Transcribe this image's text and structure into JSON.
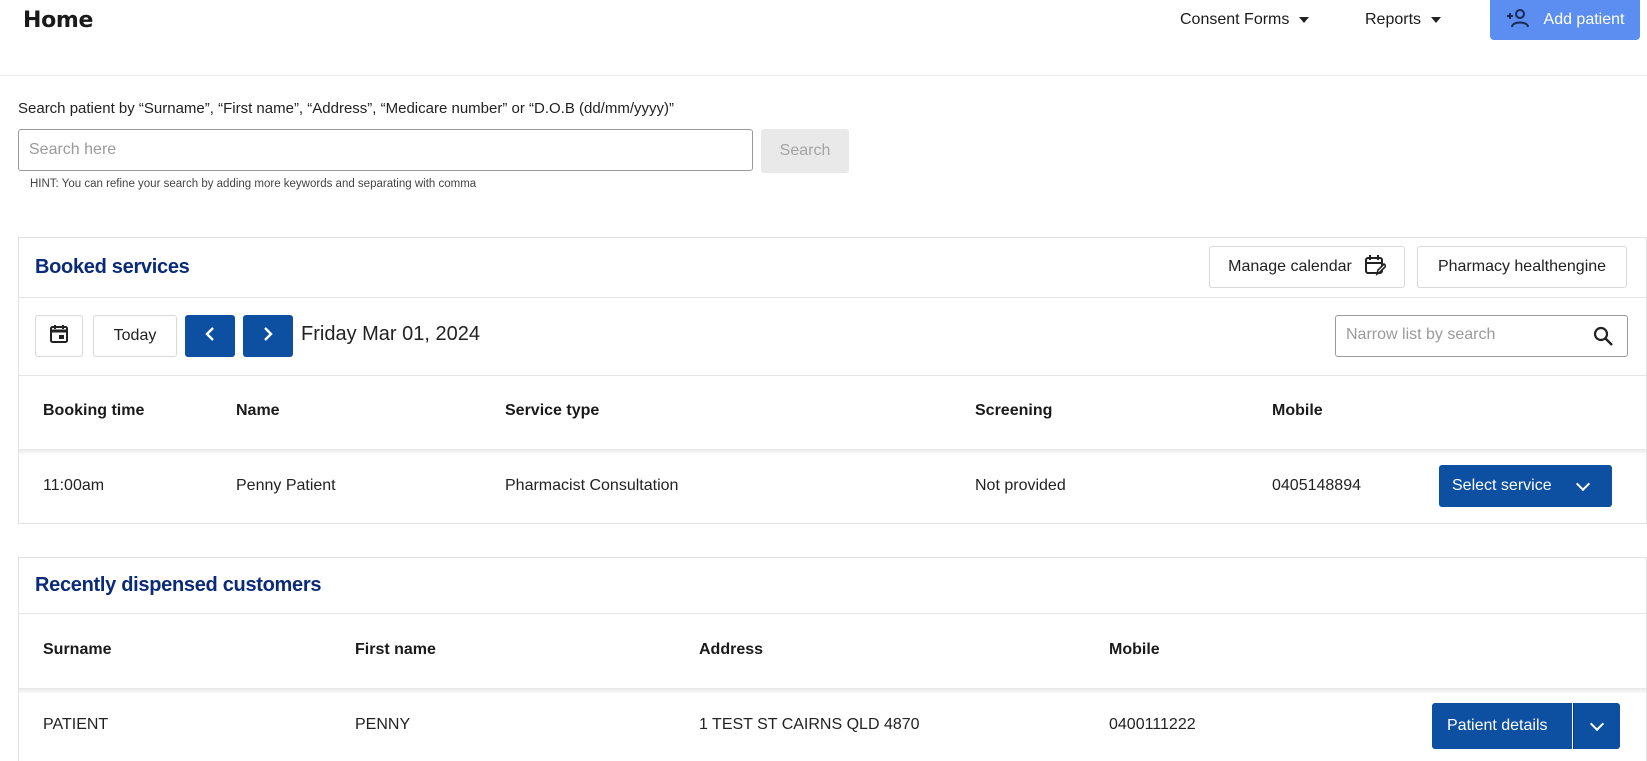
{
  "header": {
    "title": "Home",
    "consent_forms_label": "Consent Forms",
    "reports_label": "Reports",
    "add_patient_label": "Add patient"
  },
  "search": {
    "label": "Search patient by “Surname”, “First name”, “Address”, “Medicare number” or “D.O.B (dd/mm/yyyy)”",
    "placeholder": "Search here",
    "value": "",
    "button_label": "Search",
    "hint": "HINT: You can refine your search by adding more keywords and separating with comma"
  },
  "booked_services": {
    "title": "Booked services",
    "manage_calendar_label": "Manage calendar",
    "healthengine_label": "Pharmacy healthengine",
    "today_label": "Today",
    "date": "Friday Mar 01, 2024",
    "narrow_placeholder": "Narrow list by search",
    "columns": [
      "Booking time",
      "Name",
      "Service type",
      "Screening",
      "Mobile"
    ],
    "rows": [
      {
        "booking_time": "11:00am",
        "name": "Penny Patient",
        "service_type": "Pharmacist Consultation",
        "screening": "Not provided",
        "mobile": "0405148894",
        "action_label": "Select service"
      }
    ]
  },
  "recent_customers": {
    "title": "Recently dispensed customers",
    "columns": [
      "Surname",
      "First name",
      "Address",
      "Mobile"
    ],
    "rows": [
      {
        "surname": "PATIENT",
        "first_name": "PENNY",
        "address": "1 TEST ST CAIRNS QLD 4870",
        "mobile": "0400111222",
        "action_label": "Patient details"
      }
    ]
  },
  "colors": {
    "primary": "#0d4fa0",
    "add_patient_bg": "#5b8ef0",
    "panel_title": "#0a2a7a"
  },
  "icons": {
    "add_patient": "person-add-icon",
    "manage_calendar": "calendar-edit-icon",
    "date_picker": "calendar-icon",
    "prev": "chevron-left-icon",
    "next": "chevron-right-icon",
    "narrow_search": "search-icon",
    "dropdown": "chevron-down-icon"
  }
}
